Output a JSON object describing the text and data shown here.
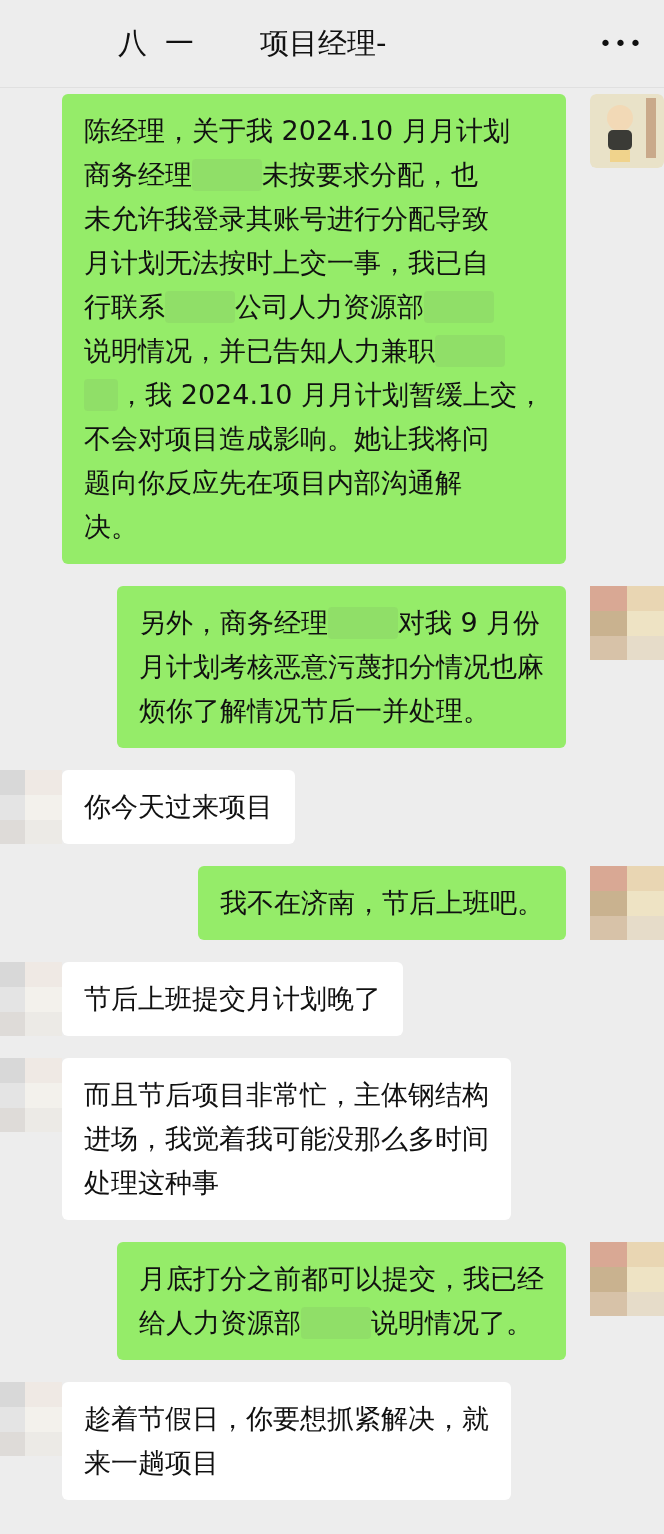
{
  "header": {
    "title_parts": [
      "八",
      "一",
      "项目经理-"
    ],
    "more": "•••"
  },
  "messages": [
    {
      "kind": "sent",
      "avatar": {
        "kind": "cartoon"
      },
      "lines": [
        [
          {
            "kind": "text",
            "text": "陈经理，关于我 2024.10 月月计划"
          }
        ],
        [
          {
            "kind": "text",
            "text": "商务经理"
          },
          {
            "kind": "redacted"
          },
          {
            "kind": "text",
            "text": "未按要求分配，也"
          }
        ],
        [
          {
            "kind": "text",
            "text": "未允许我登录其账号进行分配导致"
          }
        ],
        [
          {
            "kind": "text",
            "text": "月计划无法按时上交一事，我已自"
          }
        ],
        [
          {
            "kind": "text",
            "text": "行联系"
          },
          {
            "kind": "redacted"
          },
          {
            "kind": "text",
            "text": "公司人力资源部"
          },
          {
            "kind": "redacted"
          }
        ],
        [
          {
            "kind": "text",
            "text": "说明情况，并已告知人力兼职"
          },
          {
            "kind": "redacted"
          }
        ],
        [
          {
            "kind": "redacted"
          },
          {
            "kind": "text",
            "text": "，我 2024.10 月月计划暂缓上交，"
          }
        ],
        [
          {
            "kind": "text",
            "text": "不会对项目造成影响。她让我将问"
          }
        ],
        [
          {
            "kind": "text",
            "text": "题向你反应先在项目内部沟通解"
          }
        ],
        [
          {
            "kind": "text",
            "text": "决。"
          }
        ]
      ]
    },
    {
      "kind": "sent",
      "avatar": {
        "kind": "blurred"
      },
      "lines": [
        [
          {
            "kind": "text",
            "text": "另外，商务经理"
          },
          {
            "kind": "redacted"
          },
          {
            "kind": "text",
            "text": "对我 9 月份"
          }
        ],
        [
          {
            "kind": "text",
            "text": "月计划考核恶意污蔑扣分情况也麻"
          }
        ],
        [
          {
            "kind": "text",
            "text": "烦你了解情况节后一并处理。"
          }
        ]
      ]
    },
    {
      "kind": "received",
      "avatar": {
        "kind": "blurred"
      },
      "lines": [
        [
          {
            "kind": "text",
            "text": "你今天过来项目"
          }
        ]
      ]
    },
    {
      "kind": "sent",
      "avatar": {
        "kind": "blurred"
      },
      "lines": [
        [
          {
            "kind": "text",
            "text": "我不在济南，节后上班吧。"
          }
        ]
      ]
    },
    {
      "kind": "received",
      "avatar": {
        "kind": "blurred"
      },
      "lines": [
        [
          {
            "kind": "text",
            "text": "节后上班提交月计划晚了"
          }
        ]
      ]
    },
    {
      "kind": "received",
      "avatar": {
        "kind": "blurred"
      },
      "lines": [
        [
          {
            "kind": "text",
            "text": "而且节后项目非常忙，主体钢结构"
          }
        ],
        [
          {
            "kind": "text",
            "text": "进场，我觉着我可能没那么多时间"
          }
        ],
        [
          {
            "kind": "text",
            "text": "处理这种事"
          }
        ]
      ]
    },
    {
      "kind": "sent",
      "avatar": {
        "kind": "blurred"
      },
      "lines": [
        [
          {
            "kind": "text",
            "text": "月底打分之前都可以提交，我已经"
          }
        ],
        [
          {
            "kind": "text",
            "text": "给人力资源部"
          },
          {
            "kind": "redacted"
          },
          {
            "kind": "text",
            "text": "说明情况了。"
          }
        ]
      ]
    },
    {
      "kind": "received",
      "avatar": {
        "kind": "blurred"
      },
      "lines": [
        [
          {
            "kind": "text",
            "text": "趁着节假日，你要想抓紧解决，就"
          }
        ],
        [
          {
            "kind": "text",
            "text": "来一趟项目"
          }
        ]
      ]
    }
  ]
}
